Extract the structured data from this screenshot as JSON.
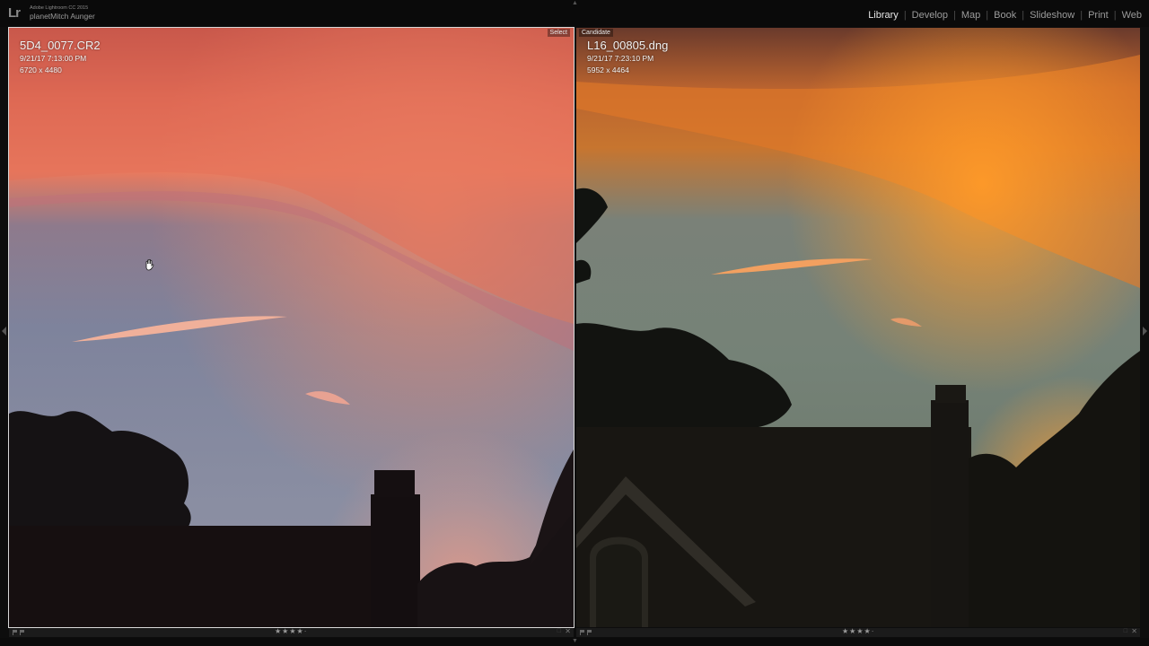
{
  "app": {
    "logo": "Lr",
    "product": "Adobe Lightroom CC 2015",
    "user": "planetMitch Aunger"
  },
  "modules": [
    {
      "label": "Library",
      "active": true
    },
    {
      "label": "Develop",
      "active": false
    },
    {
      "label": "Map",
      "active": false
    },
    {
      "label": "Book",
      "active": false
    },
    {
      "label": "Slideshow",
      "active": false
    },
    {
      "label": "Print",
      "active": false
    },
    {
      "label": "Web",
      "active": false
    }
  ],
  "compare": {
    "select": {
      "tag": "Select",
      "filename": "5D4_0077.CR2",
      "datetime": "9/21/17 7:13:00 PM",
      "dimensions": "6720 x 4480",
      "rating": "★★★★·"
    },
    "candidate": {
      "tag": "Candidate",
      "filename": "L16_00805.dng",
      "datetime": "9/21/17 7:23:10 PM",
      "dimensions": "5952 x 4464",
      "rating": "★★★★·"
    }
  },
  "icons": {
    "hand": "hand-cursor-icon",
    "flag": "flag-icon",
    "close": "close-icon"
  },
  "colors": {
    "select_sky_top": "#c24840",
    "select_sky_bottom": "#7f869e",
    "candidate_sky_top": "#7a4030",
    "candidate_sky_bottom": "#7a8778",
    "accent_active": "#e6e6e6"
  }
}
